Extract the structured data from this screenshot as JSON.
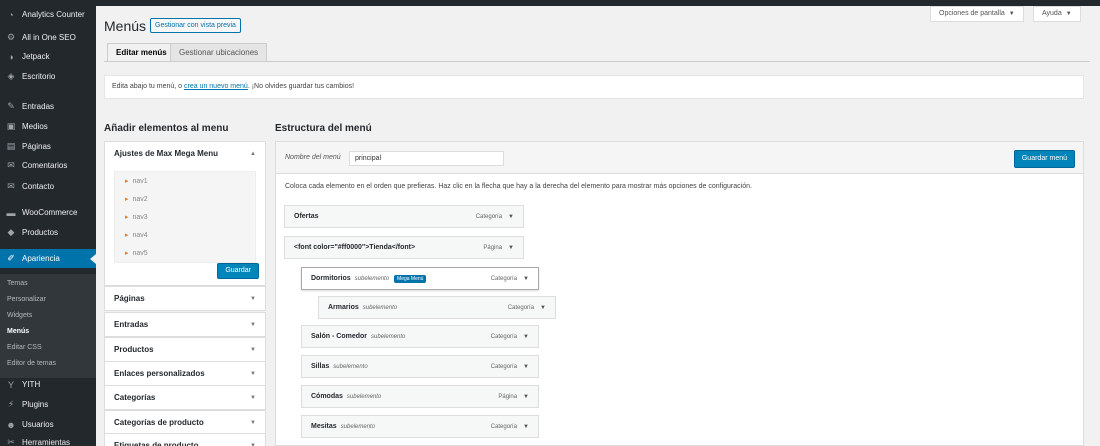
{
  "sidebar": {
    "items": [
      {
        "label": "Analytics Counter",
        "icon": "chart-circle-icon"
      },
      {
        "label": "All in One SEO",
        "icon": "gear-icon"
      },
      {
        "label": "Jetpack",
        "icon": "jetpack-icon"
      },
      {
        "label": "Escritorio",
        "icon": "palette-icon"
      },
      {
        "label": "Entradas",
        "icon": "pin-icon"
      },
      {
        "label": "Medios",
        "icon": "media-icon"
      },
      {
        "label": "Páginas",
        "icon": "page-icon"
      },
      {
        "label": "Comentarios",
        "icon": "comment-icon"
      },
      {
        "label": "Contacto",
        "icon": "mail-icon"
      },
      {
        "label": "WooCommerce",
        "icon": "woo-icon"
      },
      {
        "label": "Productos",
        "icon": "box-icon"
      },
      {
        "label": "Apariencia",
        "icon": "brush-icon"
      },
      {
        "label": "YITH",
        "icon": "yith-icon"
      },
      {
        "label": "Plugins",
        "icon": "plug-icon"
      },
      {
        "label": "Usuarios",
        "icon": "user-icon"
      },
      {
        "label": "Herramientas",
        "icon": "wrench-icon"
      }
    ],
    "submenu": [
      "Temas",
      "Personalizar",
      "Widgets",
      "Menús",
      "Editar CSS",
      "Editor de temas"
    ]
  },
  "header": {
    "title": "Menús",
    "preview_btn": "Gestionar con vista previa",
    "screen_options": "Opciones de pantalla",
    "help": "Ayuda"
  },
  "tabs": [
    "Editar menús",
    "Gestionar ubicaciones"
  ],
  "notice": {
    "before": "Edita abajo tu menú, o ",
    "link": "crea un nuevo menú",
    "after": ". ¡No olvides guardar tus cambios!"
  },
  "left": {
    "heading": "Añadir elementos al menu",
    "open_panel": "Ajustes de Max Mega Menu",
    "nav_items": [
      "nav1",
      "nav2",
      "nav3",
      "nav4",
      "nav5"
    ],
    "save": "Guardar",
    "panels": [
      "Páginas",
      "Entradas",
      "Productos",
      "Enlaces personalizados",
      "Categorías",
      "Categorías de producto",
      "Etiquetas de producto"
    ]
  },
  "right": {
    "heading": "Estructura del menú",
    "menu_name_label": "Nombre del menú",
    "menu_name_value": "principal",
    "save_menu": "Guardar menú",
    "instructions": "Coloca cada elemento en el orden que prefieras. Haz clic en la flecha que hay a la derecha del elemento para mostrar más opciones de configuración.",
    "menu_items": [
      {
        "title": "Ofertas",
        "sub": "",
        "badge": "",
        "type": "Categoría",
        "depth": 0
      },
      {
        "title": "<font color=\"#ff0000\">Tienda</font>",
        "sub": "",
        "badge": "",
        "type": "Página",
        "depth": 0
      },
      {
        "title": "Dormitorios",
        "sub": "subelemento",
        "badge": "Mega Menú",
        "type": "Categoría",
        "depth": 1
      },
      {
        "title": "Armarios",
        "sub": "subelemento",
        "badge": "",
        "type": "Categoría",
        "depth": 2
      },
      {
        "title": "Salón - Comedor",
        "sub": "subelemento",
        "badge": "",
        "type": "Categoría",
        "depth": 1
      },
      {
        "title": "Sillas",
        "sub": "subelemento",
        "badge": "",
        "type": "Categoría",
        "depth": 1
      },
      {
        "title": "Cómodas",
        "sub": "subelemento",
        "badge": "",
        "type": "Página",
        "depth": 1
      },
      {
        "title": "Mesitas",
        "sub": "subelemento",
        "badge": "",
        "type": "Categoría",
        "depth": 1
      }
    ]
  },
  "colors": {
    "accent": "#0073aa",
    "sidebar_bg": "#23282d",
    "button": "#0085ba"
  }
}
